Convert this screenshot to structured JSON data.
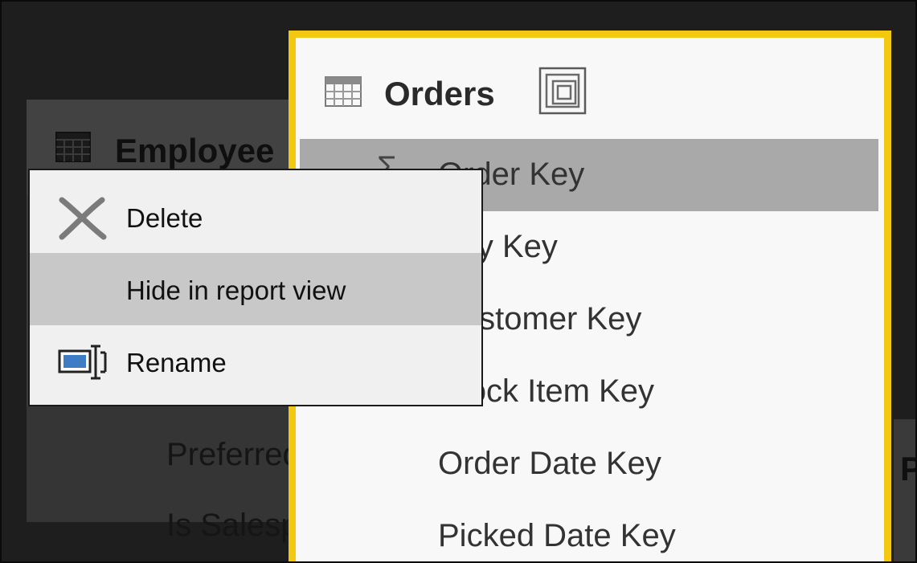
{
  "background_table": {
    "title": "Employee",
    "rows": [
      "Preferred Name",
      "Is Salesperson"
    ]
  },
  "orders_table": {
    "title": "Orders",
    "fields": [
      {
        "label": "Order Key",
        "selected": true,
        "aggregate": true
      },
      {
        "label": "City Key"
      },
      {
        "label": "Customer Key"
      },
      {
        "label": "Stock Item Key"
      },
      {
        "label": "Order Date Key"
      },
      {
        "label": "Picked Date Key"
      }
    ]
  },
  "context_menu": {
    "items": [
      {
        "label": "Delete",
        "icon": "delete-x-icon"
      },
      {
        "label": "Hide in report view",
        "icon": null,
        "hovered": true
      },
      {
        "label": "Rename",
        "icon": "rename-icon"
      }
    ]
  },
  "right_partial": {
    "letter": "P"
  },
  "colors": {
    "selection_border": "#f2c811",
    "selected_row": "#a9a9a9",
    "menu_hover": "#c8c8c8",
    "rename_icon_fill": "#3f7cc6"
  }
}
